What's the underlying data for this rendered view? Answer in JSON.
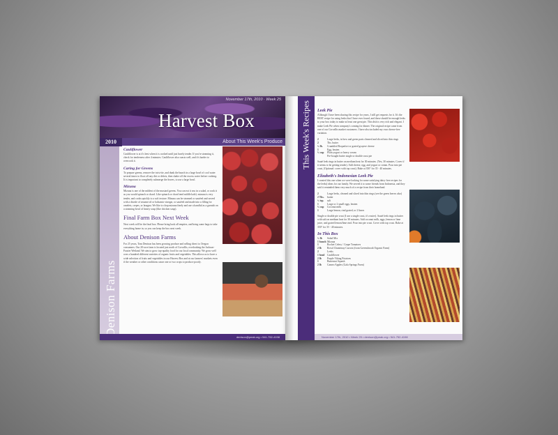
{
  "issue": {
    "date_line": "November 17th, 2010 · Week 25",
    "title": "Harvest Box",
    "year": "2010",
    "band_label": "About This Week's Produce",
    "vertical_name": "Denison Farms",
    "footer_left": "denison@peak.org • 541-752-4198",
    "footer_right": "November 17th, 2010 • Week 25 • denison@peak.org • 541-752-4198"
  },
  "left": {
    "cauliflower_head": "Cauliflower",
    "cauliflower_text": "Cauliflower is at it's best when it is cooked until just barely tender. If you're steaming it, check for tenderness after 4 minutes. Cauliflower also roasts well, and it's harder to overcook it.",
    "greens_head": "Caring for Greens",
    "greens_text": "To prepare greens, remove the twist-tie, and dunk the bunch in a large bowl of cool water several times to float off any dirt or debris, then shake off the excess water before cooking. It is important to completely submerge the leaves, to use a large bowl.",
    "mizuna_head": "Mizuna",
    "mizuna_text": "Mizuna is one of the mildest of the mustard greens. You can eat it raw in a salad, or cook it as you would spinach or chard. Like spinach or chard tend mildle kale). mizuna is very tender, and cooks quickly to a soft texture. Mizuna can be steamed or sautéed and served with a drizzle of sesame oil or balsamic vinegar, or sautéed and made into a filling for omelets, crepes, or lasagna. We like to chop mizuna finely and use a handful as a garnish on a steaming bowl of hearty soup (like chicken soup).",
    "final_head": "Final Farm Box Next Week",
    "final_text": "Next week will be the final box. Please bring back all empties, and bring some bags to take everything home in, so you can keep the box next week.",
    "about_head": "About Denison Farms",
    "about_text": "For 25 years, Tom Denison has been growing produce and selling direct to Oregon consumers. Our 20-acre farm is located just north of Corvallis, overlooking the Jackson-Frazier Wetland. We aim to grow top-quality food for our local community. We grow well over a hundred different varieties of organic fruits and vegetables. This allows us to have a wide selection of fruits and vegetables in our Harvest Box and at our farmers' markets even if the weather or other conditions cause one or two crops to produce poorly."
  },
  "right": {
    "strip_title": "This Week's Recipes",
    "leek_title": "Leek Pie",
    "leek_intro": "Although I have been sharing this recipe for years, I still get requests for it. It's the BEST recipe for using leeks that I have ever found, and these should be enough leeks to your box today to make at least one great pie. This dish is very rich and elegant. I make Leek Pie when company's coming for dinner. The original recipe came from one of our Corvallis market customers. I have also included my own cheese-free variation.",
    "leek_ings": [
      {
        "q": "2",
        "t": "Large leeks, in bow and green parts cleaned and sliced into thin rings"
      },
      {
        "q": "2",
        "t": "Tbs. butter"
      },
      {
        "q": "¼ lb.",
        "t": "Crumbled Roquefort or grated gruyere cheese"
      },
      {
        "q": "1",
        "t": "Egg, beaten"
      },
      {
        "q": "¾ cup",
        "t": "Plain yogurt or heavy cream"
      },
      {
        "q": "",
        "t": "Pre-bought butter single or double crust pie"
      }
    ],
    "leek_method": "Sauté leek rings in butter on medium heat for 30 minutes. (Yes, 30 minutes. Cover if it seems to be getting tender). Add cheese, egg, and yogurt or cream. Pour into pie crust, (Optional: cover with top crust). Bake at 350° for 35 - 40 minutes.",
    "indo_title": "Elizabeth's Indonesian Leek Pie",
    "indo_intro": "I created this one when we were looking for some satisfying dairy-free recipes for the leeks) ideas for our family. We served it to some friends from Indonesia, and they said it reminded them very much of a recipe from their homeland.",
    "indo_ings": [
      {
        "q": "2",
        "t": "Large leeks, cleaned and sliced into thin rings (see the green leaves also)"
      },
      {
        "q": "2 Tbs.",
        "t": "butter"
      },
      {
        "q": "¼ tsp.",
        "t": "salt"
      },
      {
        "q": "1",
        "t": "Large or 2 small eggs, beaten"
      },
      {
        "q": "¾ cup",
        "t": "Coconut milk"
      },
      {
        "q": "1",
        "t": "Large lemon, rind grated, or 2 limes"
      }
    ],
    "indo_method": "Single or double pie crust (I use a single crust, it's easier). Sauté leek rings in butter with salt on medium heat for 30 minutes. Add coconut milk, eggs, lemon or lime juice, and grated lemon/lime rind. Pour into pie crust. Cover with top crust. Bake at 350° for 35 - 40 minutes.",
    "box_title": "In This Box",
    "box_items": [
      {
        "q": "¼ lb",
        "t": "Salad Mix"
      },
      {
        "q": "1 bunch",
        "t": "Mizuna"
      },
      {
        "q": "1",
        "t": "Rocket Celery / Grape Tomatoes"
      },
      {
        "q": "2 lb",
        "t": "Roval Chantenay Carrots (from Greensbrook Organic Farm)"
      },
      {
        "q": "2",
        "t": "Leeks"
      },
      {
        "q": "1 head",
        "t": "Cauliflower"
      },
      {
        "q": "2 lb",
        "t": "Purple Viking Potatoes"
      },
      {
        "q": "1",
        "t": "Butternut Squash"
      },
      {
        "q": "2 lb",
        "t": "Cameo Apples (Gala Springs Farm)"
      }
    ]
  }
}
